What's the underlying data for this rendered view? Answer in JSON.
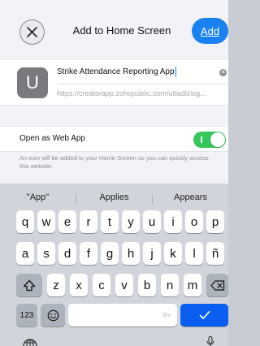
{
  "header": {
    "title": "Add to Home Screen",
    "add_label": "Add"
  },
  "app": {
    "icon_letter": "U",
    "name": "Strike Attendance Reporting App",
    "url": "https://creatorapp.zohopublic.com/utladb/sig..."
  },
  "web_app_row": {
    "label": "Open as Web App",
    "enabled": true
  },
  "description": "An icon will be added to your Home Screen so you can quickly access this website.",
  "suggestions": [
    "\"App\"",
    "Applies",
    "Appears"
  ],
  "keyboard": {
    "row1": [
      "q",
      "w",
      "e",
      "r",
      "t",
      "y",
      "u",
      "i",
      "o",
      "p"
    ],
    "row2": [
      "a",
      "s",
      "d",
      "f",
      "g",
      "h",
      "j",
      "k",
      "l",
      "ñ"
    ],
    "row3": [
      "z",
      "x",
      "c",
      "v",
      "b",
      "n",
      "m"
    ],
    "numbers_label": "123",
    "space_hint": "Bix"
  },
  "colors": {
    "accent": "#1a82f0",
    "toggle_on": "#34c759",
    "return_key": "#0a5ff0"
  }
}
